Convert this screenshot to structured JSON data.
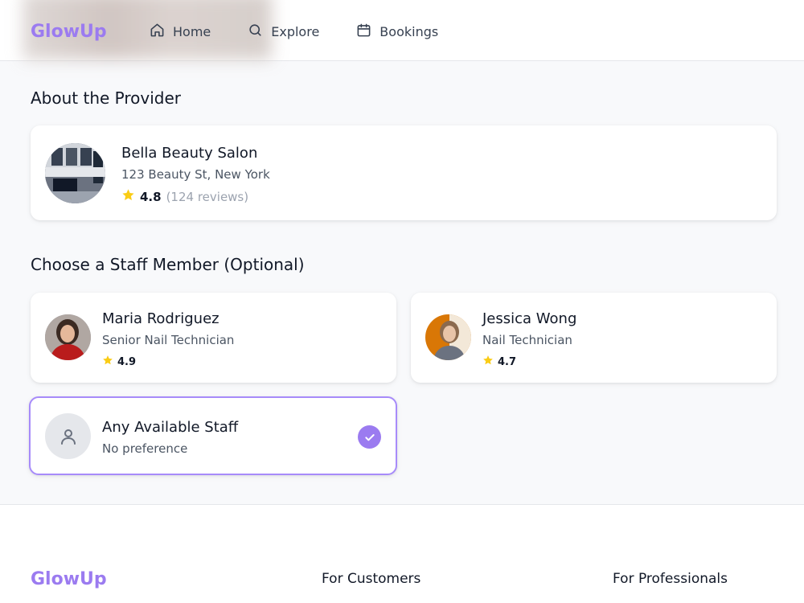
{
  "header": {
    "logo": "GlowUp",
    "nav": [
      {
        "label": "Home",
        "icon": "home-icon"
      },
      {
        "label": "Explore",
        "icon": "search-icon"
      },
      {
        "label": "Bookings",
        "icon": "calendar-icon"
      }
    ]
  },
  "about": {
    "title": "About the Provider",
    "provider": {
      "name": "Bella Beauty Salon",
      "address": "123 Beauty St, New York",
      "rating": "4.8",
      "reviews": "(124 reviews)"
    }
  },
  "staff": {
    "title": "Choose a Staff Member (Optional)",
    "members": [
      {
        "name": "Maria Rodriguez",
        "role": "Senior Nail Technician",
        "rating": "4.9"
      },
      {
        "name": "Jessica Wong",
        "role": "Nail Technician",
        "rating": "4.7"
      }
    ],
    "any": {
      "name": "Any Available Staff",
      "subtitle": "No preference",
      "selected": true
    }
  },
  "footer": {
    "logo": "GlowUp",
    "columns": [
      "For Customers",
      "For Professionals"
    ]
  },
  "colors": {
    "accent": "#9b7bf0",
    "star": "#facc15"
  }
}
